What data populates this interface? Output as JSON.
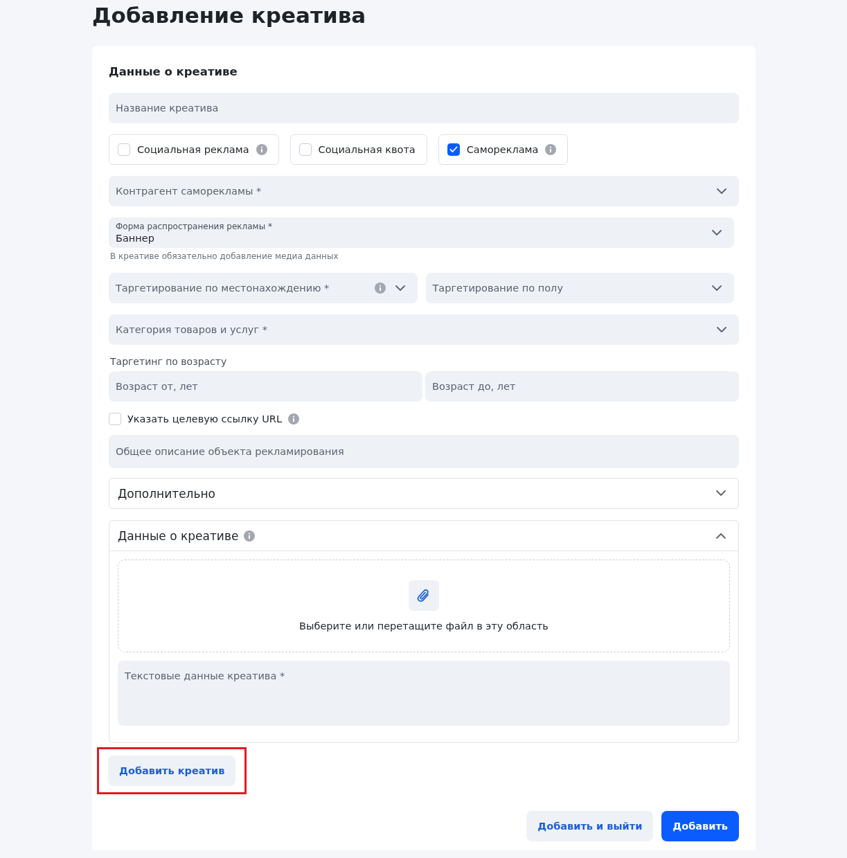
{
  "page_title": "Добавление креатива",
  "card": {
    "section_title": "Данные о креативе",
    "items": [
      {
        "kind": "input",
        "placeholder": "Название креатива"
      },
      {
        "kind": "checkbox_group",
        "options": [
          {
            "label": "Социальная реклама",
            "checked": false,
            "info": true
          },
          {
            "label": "Социальная квота",
            "checked": false,
            "info": false
          },
          {
            "label": "Самореклама",
            "checked": true,
            "info": true
          }
        ]
      },
      {
        "kind": "select",
        "placeholder": "Контрагент саморекламы *"
      },
      {
        "kind": "select",
        "label": "Форма распространения рекламы *",
        "value": "Баннер",
        "hint": "В креативе обязательно добавление медиа данных"
      },
      {
        "kind": "select_pair",
        "items": [
          {
            "placeholder": "Таргетирование по местонахождению *",
            "info": true
          },
          {
            "placeholder": "Таргетирование по полу",
            "info": false
          }
        ]
      },
      {
        "kind": "select",
        "placeholder": "Категория товаров и услуг *"
      },
      {
        "kind": "input_pair",
        "label": "Таргетинг по возрасту",
        "items": [
          {
            "placeholder": "Возраст от, лет"
          },
          {
            "placeholder": "Возраст до, лет"
          }
        ]
      },
      {
        "kind": "checkbox",
        "label": "Указать целевую ссылку URL",
        "checked": false,
        "info": true
      },
      {
        "kind": "textarea",
        "placeholder": "Общее описание объекта рекламирования"
      },
      {
        "kind": "accordion",
        "title": "Дополнительно",
        "info": false,
        "expanded": false
      },
      {
        "kind": "accordion",
        "title": "Данные о креативе",
        "info": true,
        "expanded": true,
        "dropzone": "Выберите или перетащите файл в эту область",
        "textarea": "Текстовые данные креатива *"
      }
    ],
    "add_button": {
      "label": "Добавить креатив",
      "highlighted": true
    },
    "footer_buttons": [
      {
        "label": "Добавить и выйти",
        "primary": false
      },
      {
        "label": "Добавить",
        "primary": true
      }
    ]
  }
}
